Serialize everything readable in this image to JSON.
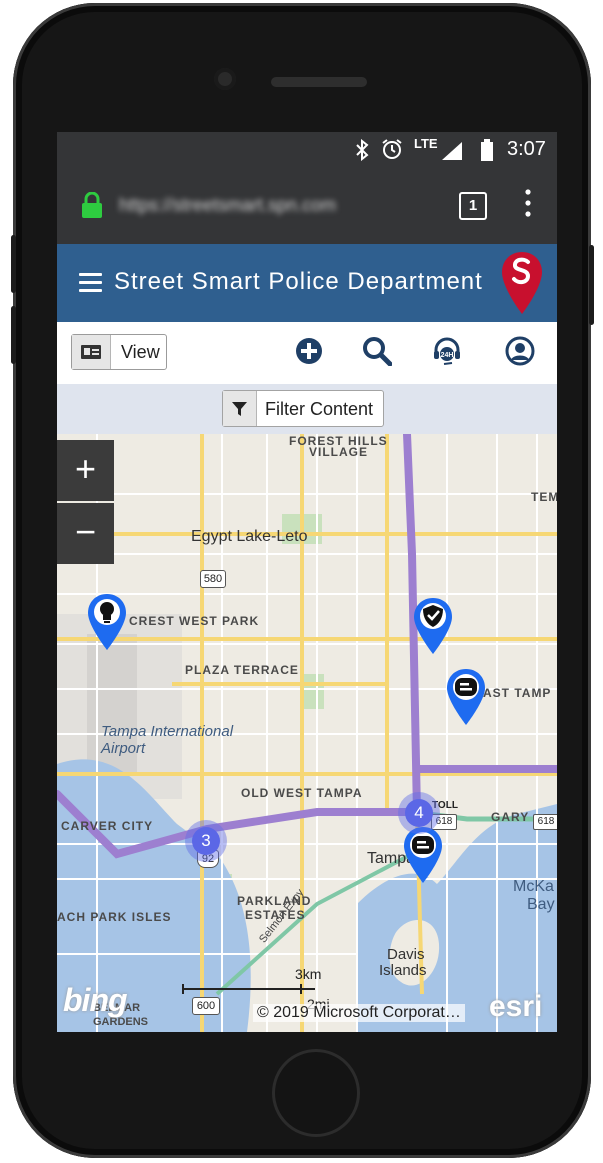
{
  "status_bar": {
    "time": "3:07",
    "network": "LTE",
    "icons": [
      "bluetooth-icon",
      "alarm-icon",
      "signal-icon",
      "battery-icon"
    ]
  },
  "browser": {
    "url": "https://streetsmart.spn.com",
    "tab_count": "1",
    "lock_color": "#2ecc40"
  },
  "app": {
    "title": "Street Smart Police Department",
    "header_color": "#2f5f8f",
    "logo_letter": "S",
    "logo_color": "#c8102e"
  },
  "toolbar": {
    "view_label": "View",
    "icons": [
      "add-icon",
      "search-icon",
      "24h-support-icon",
      "user-account-icon"
    ]
  },
  "filter": {
    "label": "Filter Content"
  },
  "map": {
    "zoom_in": "+",
    "zoom_out": "−",
    "labels": {
      "forest_hills": "FOREST HILLS",
      "village": "VILLAGE",
      "egypt_lake": "Egypt Lake-Leto",
      "crest_west_park": "CREST WEST PARK",
      "plaza_terrace": "PLAZA TERRACE",
      "tampa_intl": "Tampa International",
      "airport": "Airport",
      "old_west_tampa": "OLD WEST TAMPA",
      "carver_city": "CARVER CITY",
      "parkland": "PARKLAND",
      "estates": "ESTATES",
      "tampa": "Tampa",
      "beach_park_isles": "ACH PARK ISLES",
      "davis": "Davis",
      "islands": "Islands",
      "mckay": "McKa",
      "bay": "Bay",
      "east_tamp": "AST TAMP",
      "tem": "TEM",
      "gary": "GARY",
      "toll": "TOLL",
      "selmon": "Selmon Expy",
      "belmar": "BELMAR",
      "gardens": "GARDENS"
    },
    "route_shields": {
      "r580": "580",
      "r92": "92",
      "r600": "600",
      "r618": "618",
      "r618b": "618"
    },
    "clusters": [
      {
        "name": "cluster-3",
        "count": "3"
      },
      {
        "name": "cluster-4",
        "count": "4"
      }
    ],
    "scale": {
      "km": "3km",
      "mi": "2mi"
    },
    "credit": "© 2019 Microsoft Corporat…",
    "provider_logo": "bing",
    "esri_logo": "esri"
  }
}
